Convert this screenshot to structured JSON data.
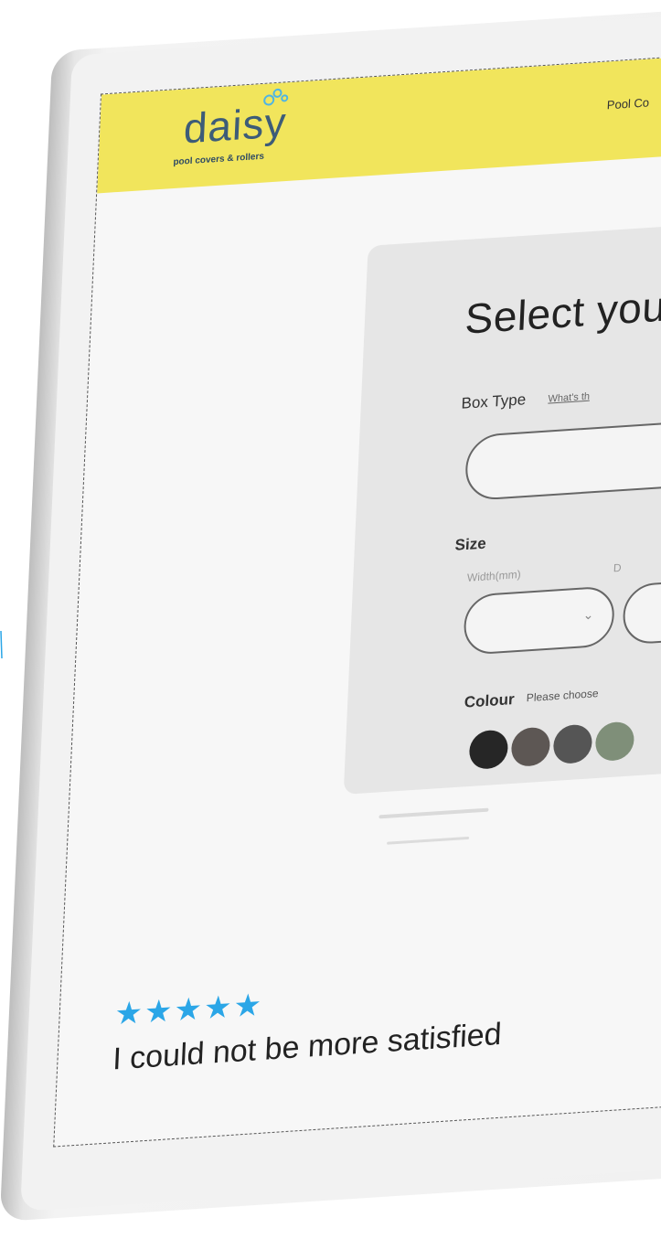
{
  "header": {
    "logo_word": "daisy",
    "logo_tagline": "pool covers & rollers",
    "nav_partial": "Pool Co"
  },
  "configurator": {
    "title": "Select your",
    "box_type_label": "Box Type",
    "box_type_help": "What's th",
    "box_type_value": "",
    "size_label": "Size",
    "width_label": "Width(mm)",
    "depth_label_partial": "D",
    "colour_label": "Colour",
    "colour_hint": "Please choose",
    "swatches": [
      "#262626",
      "#5d5754",
      "#555555",
      "#7f8f79"
    ]
  },
  "review": {
    "stars": "★★★★★",
    "text": "I could not be more satisfied"
  },
  "colors": {
    "brand_yellow": "#f1e55c",
    "logo_blue": "#3d5c78",
    "star_blue": "#2ba6e7"
  }
}
